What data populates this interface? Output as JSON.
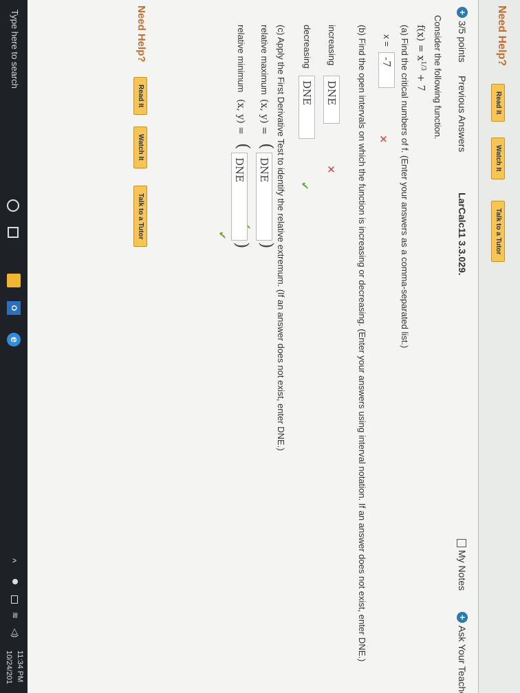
{
  "previous_help": {
    "need_help": "Need Help?",
    "read_it": "Read It",
    "watch_it": "Watch It",
    "talk_tutor": "Talk to a Tutor"
  },
  "question": {
    "points": "3/5 points",
    "previous_answers": "Previous Answers",
    "reference": "LarCalc11 3.3.029.",
    "my_notes": "My Notes",
    "ask_teacher": "Ask Your Teacher"
  },
  "prompt": "Consider the following function.",
  "function": "f(x) = x^(1/3) + 7",
  "part_a": {
    "text": "(a) Find the critical numbers of f. (Enter your answers as a comma-separated list.)",
    "label": "x =",
    "answer": "-7",
    "status": "incorrect"
  },
  "part_b": {
    "text": "(b) Find the open intervals on which the function is increasing or decreasing. (Enter your answers using interval notation. If an answer does not exist, enter DNE.)",
    "increasing_label": "increasing",
    "increasing_answer": "DNE",
    "increasing_status": "incorrect",
    "decreasing_label": "decreasing",
    "decreasing_answer": "DNE",
    "decreasing_status": "correct"
  },
  "part_c": {
    "text": "(c) Apply the First Derivative Test to identify the relative extremum. (If an answer does not exist, enter DNE.)",
    "max_label": "relative maximum",
    "max_xy": "(x, y) =",
    "max_answer": "DNE",
    "max_status": "correct",
    "min_label": "relative minimum",
    "min_xy": "(x, y) =",
    "min_answer": "DNE",
    "min_status": "correct"
  },
  "help": {
    "need_help": "Need Help?",
    "read_it": "Read It",
    "watch_it": "Watch It",
    "talk_tutor": "Talk to a Tutor"
  },
  "taskbar": {
    "search_placeholder": "Type here to search",
    "time": "11:34 PM",
    "date": "10/24/201"
  },
  "colors": {
    "accent": "#2a7ab8",
    "help_orange": "#c96c2a",
    "button_yellow": "#f6c553",
    "incorrect": "#d0453a",
    "correct": "#6aaa34"
  }
}
